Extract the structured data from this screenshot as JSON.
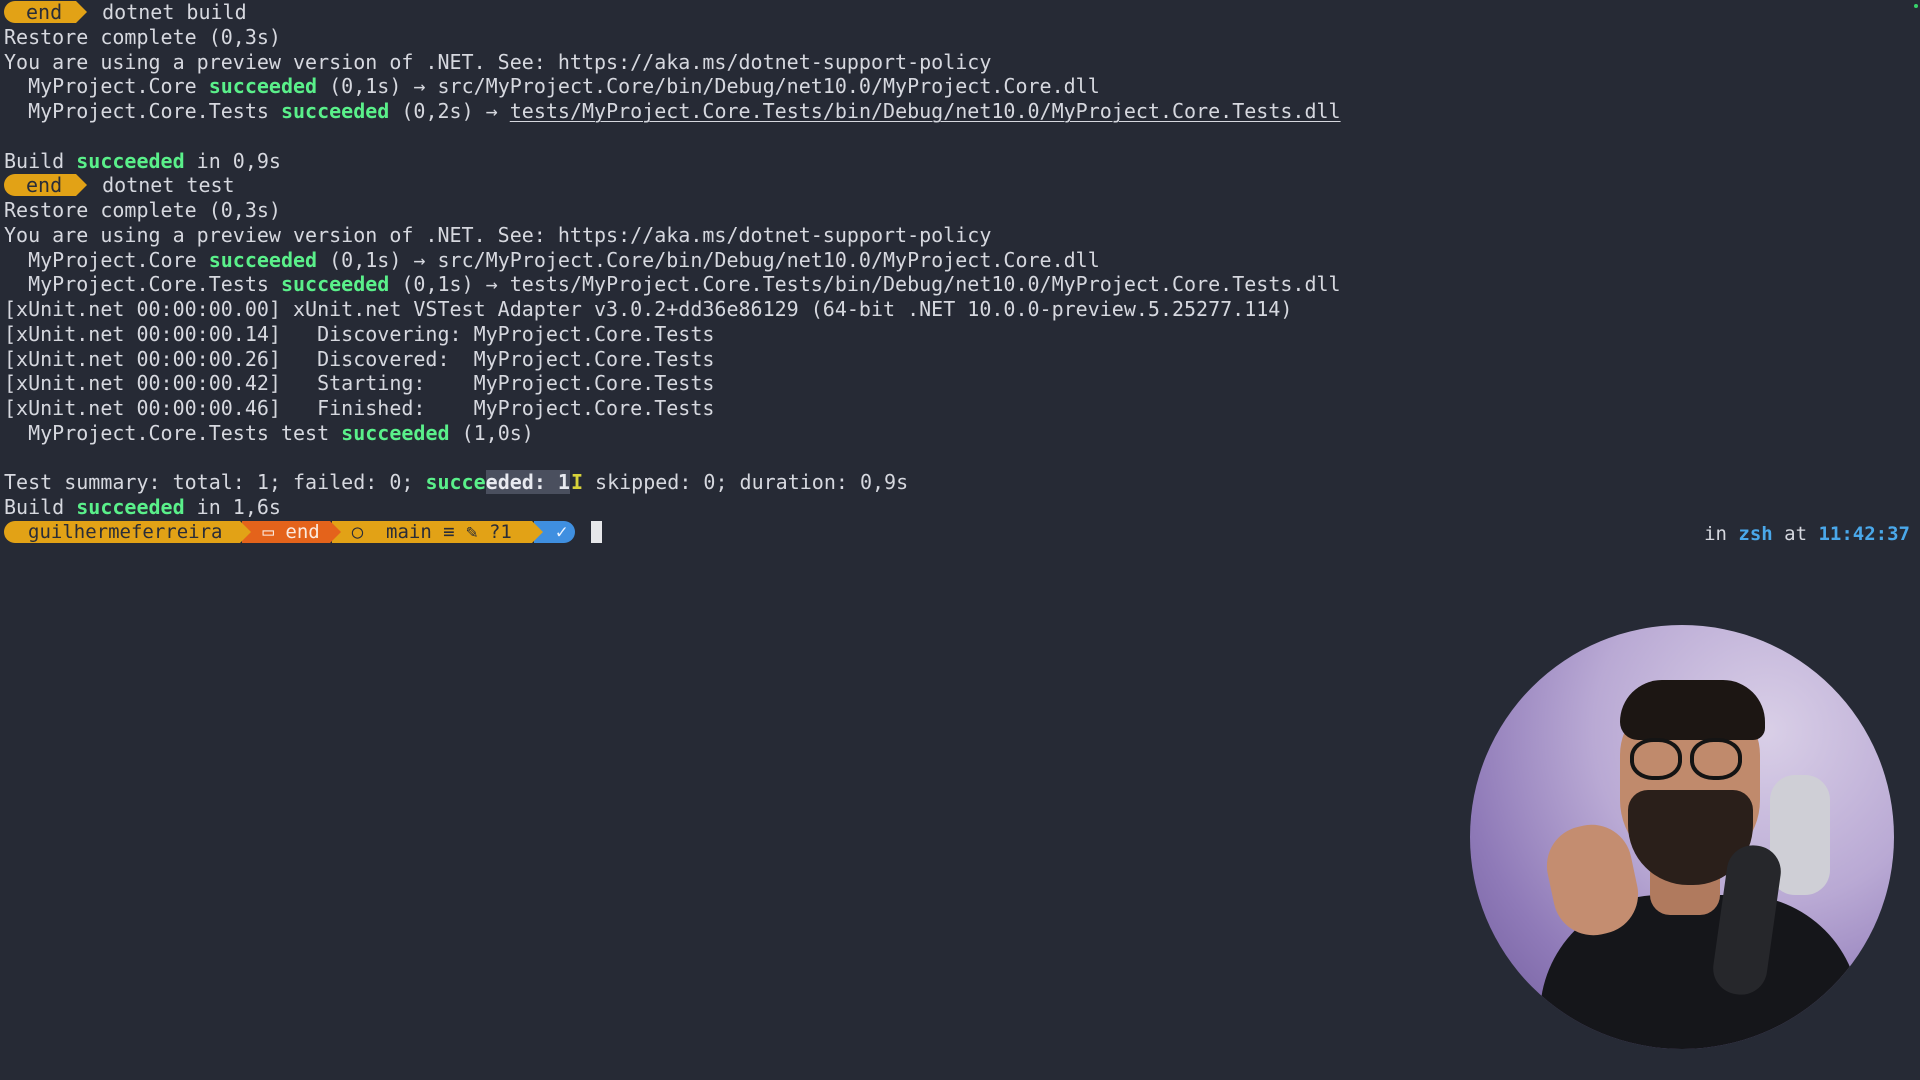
{
  "terminal": {
    "block1": {
      "prompt_dir": "end",
      "command": "dotnet build",
      "restore": "Restore complete (0,3s)",
      "preview_notice": "You are using a preview version of .NET. See: https://aka.ms/dotnet-support-policy",
      "proj1_name": "  MyProject.Core ",
      "proj1_status": "succeeded",
      "proj1_rest": " (0,1s) → src/MyProject.Core/bin/Debug/net10.0/MyProject.Core.dll",
      "proj2_name": "  MyProject.Core.Tests ",
      "proj2_status": "succeeded",
      "proj2_mid": " (0,2s) → ",
      "proj2_path": "tests/MyProject.Core.Tests/bin/Debug/net10.0/MyProject.Core.Tests.dll",
      "build_pre": "Build ",
      "build_status": "succeeded",
      "build_post": " in 0,9s"
    },
    "block2": {
      "prompt_dir": "end",
      "command": "dotnet test",
      "restore": "Restore complete (0,3s)",
      "preview_notice": "You are using a preview version of .NET. See: https://aka.ms/dotnet-support-policy",
      "proj1_name": "  MyProject.Core ",
      "proj1_status": "succeeded",
      "proj1_rest": " (0,1s) → src/MyProject.Core/bin/Debug/net10.0/MyProject.Core.dll",
      "proj2_name": "  MyProject.Core.Tests ",
      "proj2_status": "succeeded",
      "proj2_rest": " (0,1s) → tests/MyProject.Core.Tests/bin/Debug/net10.0/MyProject.Core.Tests.dll",
      "xunit_lines": [
        "[xUnit.net 00:00:00.00] xUnit.net VSTest Adapter v3.0.2+dd36e86129 (64-bit .NET 10.0.0-preview.5.25277.114)",
        "[xUnit.net 00:00:00.14]   Discovering: MyProject.Core.Tests",
        "[xUnit.net 00:00:00.26]   Discovered:  MyProject.Core.Tests",
        "[xUnit.net 00:00:00.42]   Starting:    MyProject.Core.Tests",
        "[xUnit.net 00:00:00.46]   Finished:    MyProject.Core.Tests"
      ],
      "test_pre": "  MyProject.Core.Tests test ",
      "test_status": "succeeded",
      "test_post": " (1,0s)",
      "summary_pre": "Test summary: total: 1; failed: 0; ",
      "summary_ok_a": "succe",
      "summary_ok_b": "eded: 1",
      "summary_caret": "I",
      "summary_post": " skipped: 0; duration: 0,9s",
      "build_pre": "Build ",
      "build_status": "succeeded",
      "build_post": " in 1,6s"
    },
    "prompt": {
      "user": "guilhermeferreira",
      "dir_icon": "▭",
      "dir": "end",
      "git_icon": "○",
      "branch": "main ≡ ✎ ?1",
      "status_icon": "✓"
    },
    "right_prompt": {
      "in": "in ",
      "shell": "zsh",
      "at": " at ",
      "time": "11:42:37"
    }
  },
  "webcam": {
    "icon": "presenter-video"
  },
  "colors": {
    "background": "#262a35",
    "success": "#5af08a",
    "prompt_yellow": "#e2a216",
    "prompt_orange": "#e4631b",
    "prompt_blue": "#3f8fe0"
  }
}
